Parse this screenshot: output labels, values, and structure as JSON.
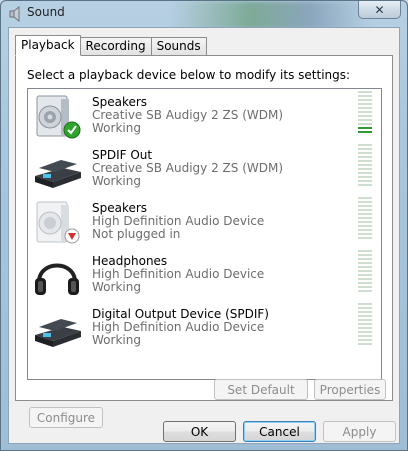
{
  "window": {
    "title": "Sound",
    "close_glyph": "✕"
  },
  "tabs": [
    {
      "label": "Playback",
      "active": true
    },
    {
      "label": "Recording",
      "active": false
    },
    {
      "label": "Sounds",
      "active": false
    }
  ],
  "instructions": "Select a playback device below to modify its settings:",
  "devices": [
    {
      "name": "Speakers",
      "description": "Creative SB Audigy 2 ZS (WDM)",
      "status": "Working",
      "icon": "speaker-default-icon",
      "badge": "check-badge",
      "meter_level": 0.18
    },
    {
      "name": "SPDIF Out",
      "description": "Creative SB Audigy 2 ZS (WDM)",
      "status": "Working",
      "icon": "digital-output-device-icon",
      "meter_level": 0
    },
    {
      "name": "Speakers",
      "description": "High Definition Audio Device",
      "status": "Not plugged in",
      "icon": "speaker-unplugged-icon",
      "badge": "unplugged-badge",
      "meter_level": 0
    },
    {
      "name": "Headphones",
      "description": "High Definition Audio Device",
      "status": "Working",
      "icon": "headphones-icon",
      "meter_level": 0
    },
    {
      "name": "Digital Output Device (SPDIF)",
      "description": "High Definition Audio Device",
      "status": "Working",
      "icon": "digital-output-device-icon",
      "meter_level": 0
    }
  ],
  "buttons": {
    "configure": "Configure",
    "set_default": "Set Default",
    "properties": "Properties",
    "ok": "OK",
    "cancel": "Cancel",
    "apply": "Apply"
  },
  "colors": {
    "meter_active": "#2f9a2f",
    "meter_idle": "#cfdfcf",
    "check_badge": "#2fa52f",
    "unplugged_badge": "#d3302f"
  }
}
